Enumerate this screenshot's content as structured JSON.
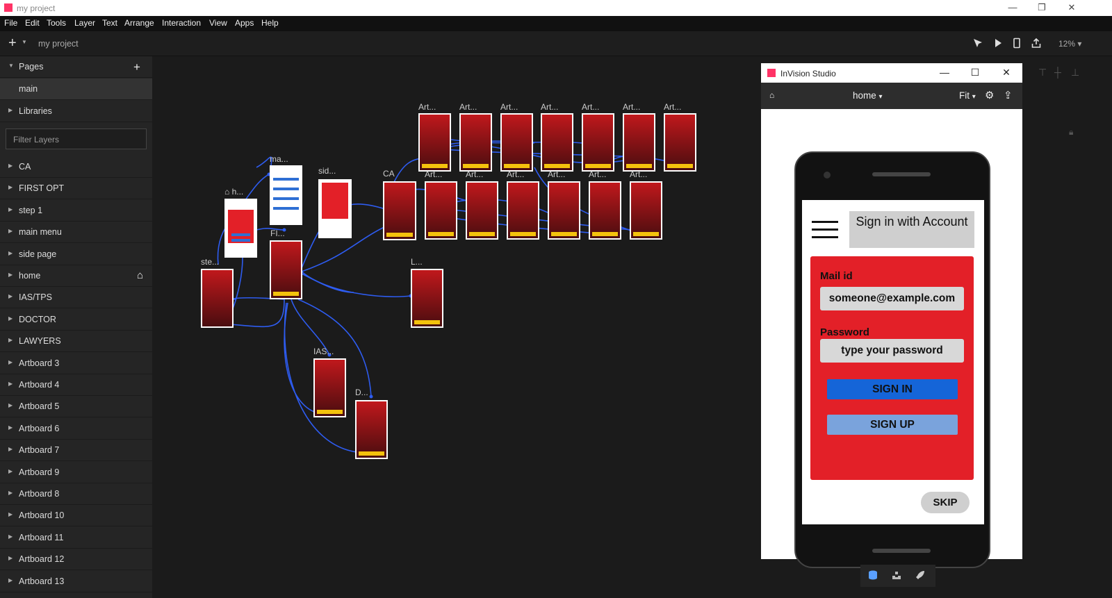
{
  "window": {
    "title": "my project",
    "minimize": "—",
    "restore": "❐",
    "close": "✕"
  },
  "menu": [
    "File",
    "Edit",
    "Tools",
    "Layer",
    "Text",
    "Arrange",
    "Interaction",
    "View",
    "Apps",
    "Help"
  ],
  "toolbar": {
    "add": "+",
    "add_caret": "▼",
    "project_name": "my project",
    "zoom": "12%",
    "zoom_caret": "▾"
  },
  "sidebar": {
    "pages_label": "Pages",
    "pages_add": "+",
    "current_page": "main",
    "libraries_label": "Libraries",
    "filter_placeholder": "Filter Layers",
    "layers": [
      "CA",
      "FIRST OPT",
      "step 1",
      "main menu",
      "side page",
      "home",
      "IAS/TPS",
      "DOCTOR",
      "LAWYERS",
      "Artboard 3",
      "Artboard 4",
      "Artboard 5",
      "Artboard 6",
      "Artboard 7",
      "Artboard 9",
      "Artboard 8",
      "Artboard 10",
      "Artboard 11",
      "Artboard 12",
      "Artboard 13"
    ],
    "home_layer_icon": "home-icon"
  },
  "canvas": {
    "labels": {
      "ma": "ma...",
      "h": "h...",
      "sid": "sid...",
      "ste": "ste...",
      "fi": "FI...",
      "ca": "CA",
      "l": "L...",
      "ias": "IAS...",
      "d": "D...",
      "art": "Art..."
    },
    "link_color": "#2e5cf0",
    "artboard_fill": "#c0181c",
    "back_bar_color": "#f4c20d"
  },
  "preview": {
    "app_title": "InVision Studio",
    "minimize": "—",
    "maximize": "☐",
    "close": "✕",
    "page": "home",
    "page_caret": "▾",
    "fit": "Fit",
    "fit_caret": "▾",
    "home_icon": "⌂",
    "gear_icon": "⚙",
    "share_icon": "⇪",
    "screen": {
      "signin_title": "Sign in with Account",
      "mail_label": "Mail id",
      "mail_value": "someone@example.com",
      "password_label": "Password",
      "password_placeholder": "type your password",
      "signin_button": "SIGN IN",
      "signup_button": "SIGN UP",
      "skip_button": "SKIP",
      "colors": {
        "form": "#e32028",
        "signin": "#1565d8",
        "signup": "#7aa3dc",
        "fields": "#d8d8d8"
      }
    }
  }
}
